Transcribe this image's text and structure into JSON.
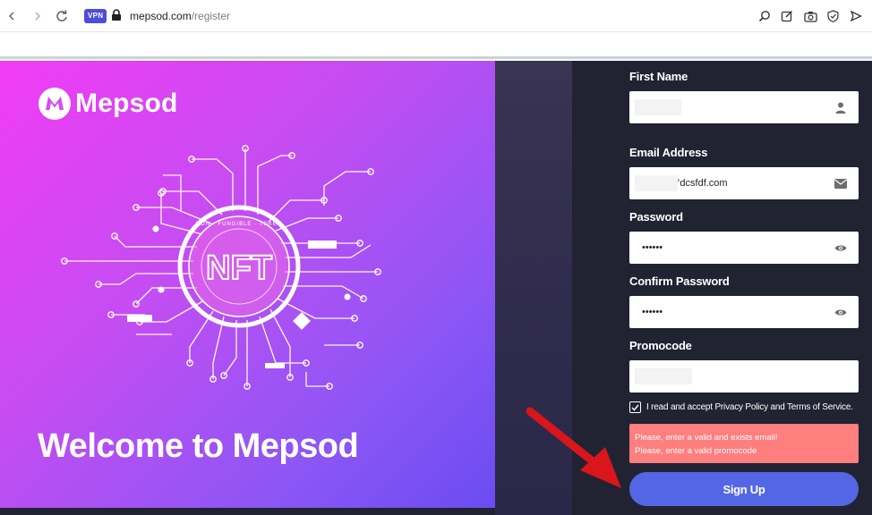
{
  "browser": {
    "vpn_label": "VPN",
    "url_domain": "mepsod.com",
    "url_path": "/register",
    "icons": [
      "back-icon",
      "forward-icon",
      "reload-icon",
      "lock-icon",
      "search-icon",
      "edit-icon",
      "camera-icon",
      "shield-icon",
      "send-icon"
    ]
  },
  "hero": {
    "brand": "Mepsod",
    "welcome": "Welcome to Mepsod",
    "art_text": "NFT",
    "art_ring_text": "NON · FUNGIBLE · TOKEN",
    "gradient": [
      "#f23cf4",
      "#8d56f5",
      "#6a4cf1"
    ]
  },
  "form": {
    "first_name_label": "First Name",
    "first_name_value": "",
    "email_label": "Email Address",
    "email_value": "°dcsfdf.com",
    "password_label": "Password",
    "password_value": "••••••",
    "confirm_password_label": "Confirm Password",
    "confirm_password_value": "••••••",
    "promocode_label": "Promocode",
    "promocode_value": "",
    "terms_text": "I read and accept Privacy Policy and Terms of Service.",
    "terms_checked": true,
    "errors": [
      "Please, enter a valid and exists email!",
      "Please, enter a valid promocode"
    ],
    "signup_label": "Sign Up"
  },
  "colors": {
    "page_bg": "#212332",
    "button": "#5367e4",
    "error_bg": "#ff7e7e",
    "arrow": "#d9161b"
  }
}
